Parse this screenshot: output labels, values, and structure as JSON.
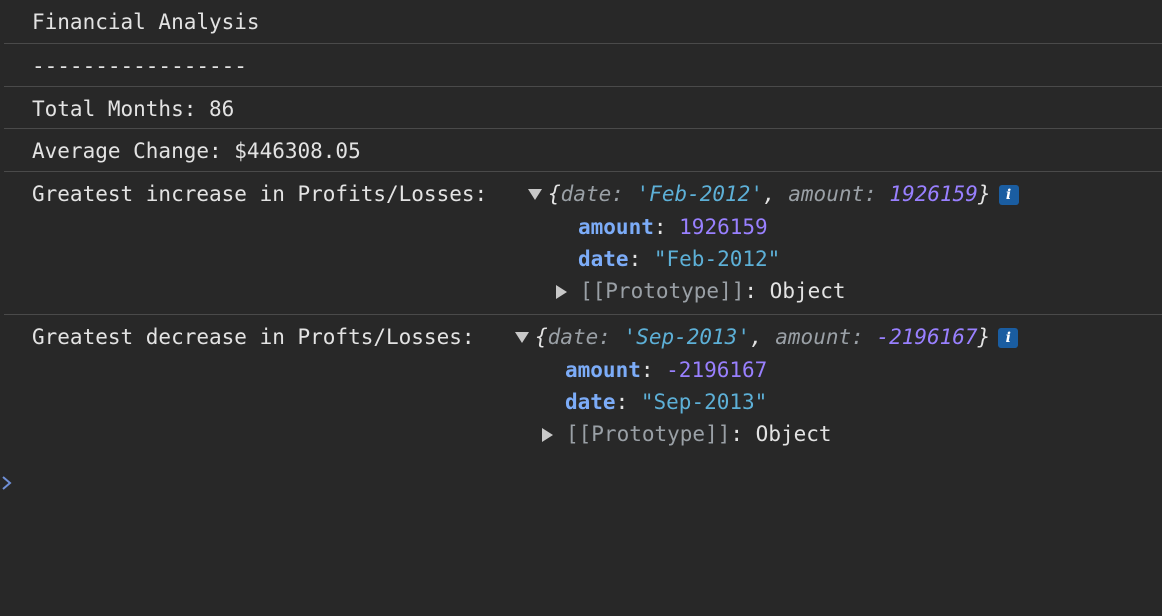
{
  "console": {
    "lines": [
      "Financial Analysis",
      "-----------------",
      "Total Months: 86",
      "Average Change: $446308.05"
    ],
    "increase": {
      "label": "Greatest increase in Profits/Losses:",
      "preview": {
        "date_key": "date",
        "date_value": "'Feb-2012'",
        "amount_key": "amount",
        "amount_value": "1926159"
      },
      "props": {
        "amount_key": "amount",
        "amount_value": "1926159",
        "date_key": "date",
        "date_value": "\"Feb-2012\"",
        "proto_key": "[[Prototype]]",
        "proto_value": "Object"
      }
    },
    "decrease": {
      "label": "Greatest decrease in Profts/Losses:",
      "preview": {
        "date_key": "date",
        "date_value": "'Sep-2013'",
        "amount_key": "amount",
        "amount_value": "-2196167"
      },
      "props": {
        "amount_key": "amount",
        "amount_value": "-2196167",
        "date_key": "date",
        "date_value": "\"Sep-2013\"",
        "proto_key": "[[Prototype]]",
        "proto_value": "Object"
      }
    },
    "info_badge": "i"
  },
  "colors": {
    "background": "#282828",
    "text": "#e3e3e3",
    "separator": "#4a4a4a",
    "key": "#7cacf8",
    "number": "#9980ff",
    "string": "#5db0d7",
    "muted": "#9aa0a6",
    "badge": "#1a5da1",
    "prompt": "#6f8fd6"
  },
  "icons": {
    "expand": "triangle-down-icon",
    "collapse": "triangle-right-icon",
    "info": "info-icon",
    "prompt": "chevron-right-icon"
  }
}
